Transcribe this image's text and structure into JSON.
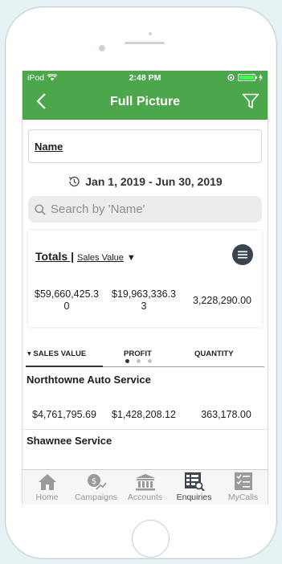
{
  "status": {
    "carrier": "iPod",
    "time": "2:48 PM"
  },
  "header": {
    "title": "Full Picture"
  },
  "name_field": {
    "label": "Name"
  },
  "date_range": {
    "text": "Jan 1, 2019 - Jun 30, 2019"
  },
  "search": {
    "placeholder": "Search by 'Name'"
  },
  "totals": {
    "title": "Totals |",
    "metric": "Sales Value",
    "arrow": "▼",
    "sales_line1": "$59,660,425.3",
    "sales_line2": "0",
    "profit_line1": "$19,963,336.3",
    "profit_line2": "3",
    "quantity": "3,228,290.00"
  },
  "tabs": {
    "sales": "▾ SALES VALUE",
    "profit": "PROFIT",
    "quantity": "QUANTITY"
  },
  "rows": [
    {
      "name": "Northtowne Auto Service",
      "sales": "$4,761,795.69",
      "profit": "$1,428,208.12",
      "quantity": "363,178.00"
    },
    {
      "name": "Shawnee Service"
    }
  ],
  "tabbar": [
    {
      "label": "Home",
      "icon": "home-icon"
    },
    {
      "label": "Campaigns",
      "icon": "campaigns-icon"
    },
    {
      "label": "Accounts",
      "icon": "accounts-icon"
    },
    {
      "label": "Enquiries",
      "icon": "enquiries-icon"
    },
    {
      "label": "MyCalls",
      "icon": "mycalls-icon"
    }
  ],
  "colors": {
    "accent": "#4ca64c",
    "active_tab": "#3c4653",
    "menu_button": "#3a4350"
  }
}
